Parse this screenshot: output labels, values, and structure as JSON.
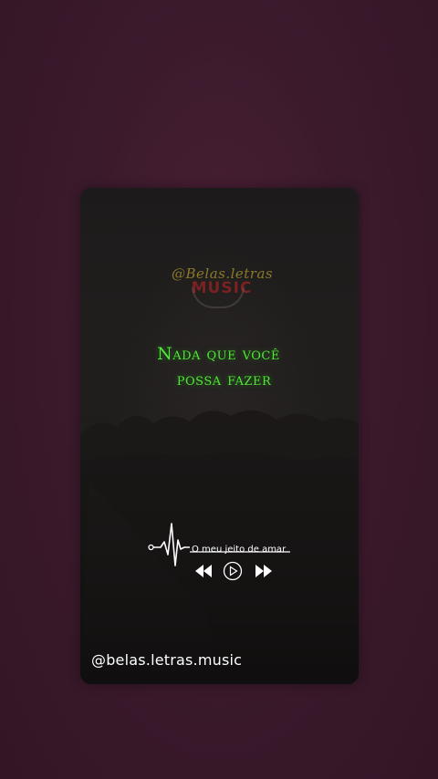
{
  "logo": {
    "top_text": "@Belas.letras",
    "bottom_text": "MUSIC"
  },
  "lyrics": {
    "line1": "Nada que você",
    "line2": "possa fazer"
  },
  "player": {
    "song_title": "O meu jeito de amar",
    "controls": [
      "rewind-icon",
      "play-icon",
      "fast-forward-icon"
    ]
  },
  "handle": "@belas.letras.music",
  "colors": {
    "background": "#3b1a2c",
    "lyrics": "#55e63a",
    "text": "#ffffff"
  }
}
